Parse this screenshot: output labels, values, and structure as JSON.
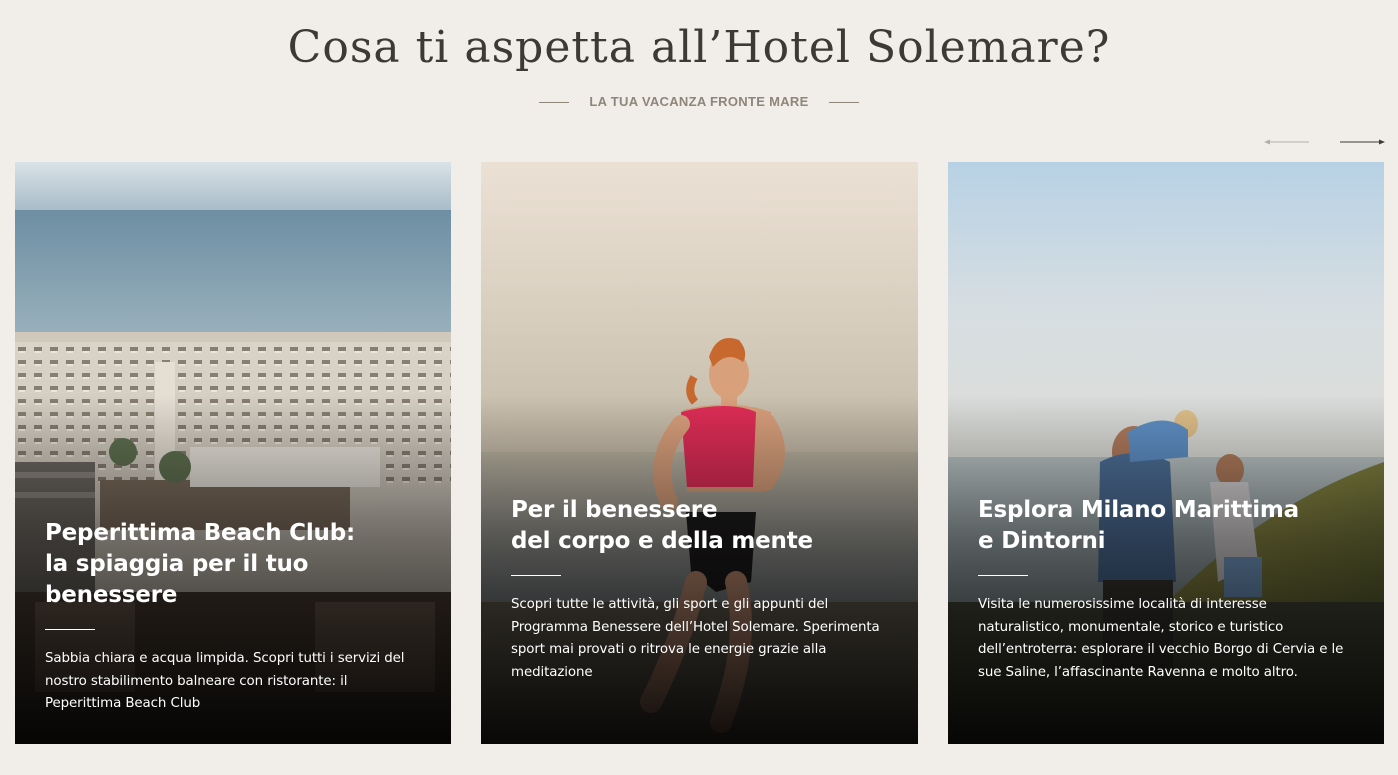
{
  "header": {
    "title": "Cosa ti aspetta all’Hotel Solemare?",
    "subtitle": "LA TUA VACANZA FRONTE MARE"
  },
  "carousel": {
    "prev_icon": "arrow-left-icon",
    "next_icon": "arrow-right-icon",
    "cards": [
      {
        "title": "Peperittima Beach Club:\nla spiaggia per il tuo benessere",
        "text": "Sabbia chiara e acqua limpida. Scopri tutti i servizi del nostro stabilimento balneare con ristorante: il Peperittima Beach Club",
        "image": "beach-club-aerial-photo"
      },
      {
        "title": "Per il benessere\ndel corpo e della mente",
        "text": "Scopri tutte le attività, gli sport e gli appunti del Programma Benessere dell’Hotel Solemare. Sperimenta sport mai provati o ritrova le energie grazie alla meditazione",
        "image": "woman-running-on-beach-photo"
      },
      {
        "title": "Esplora Milano Marittima\ne Dintorni",
        "text": "Visita le numerosissime località di interesse naturalistico, monumentale, storico e turistico dell’entroterra: esplorare il vecchio Borgo di Cervia e le sue Saline, l’affascinante Ravenna e molto altro.",
        "image": "family-by-lagoon-photo"
      }
    ]
  },
  "colors": {
    "background": "#f1eee9",
    "title": "#3d3935",
    "subtitle": "#8d8679"
  }
}
